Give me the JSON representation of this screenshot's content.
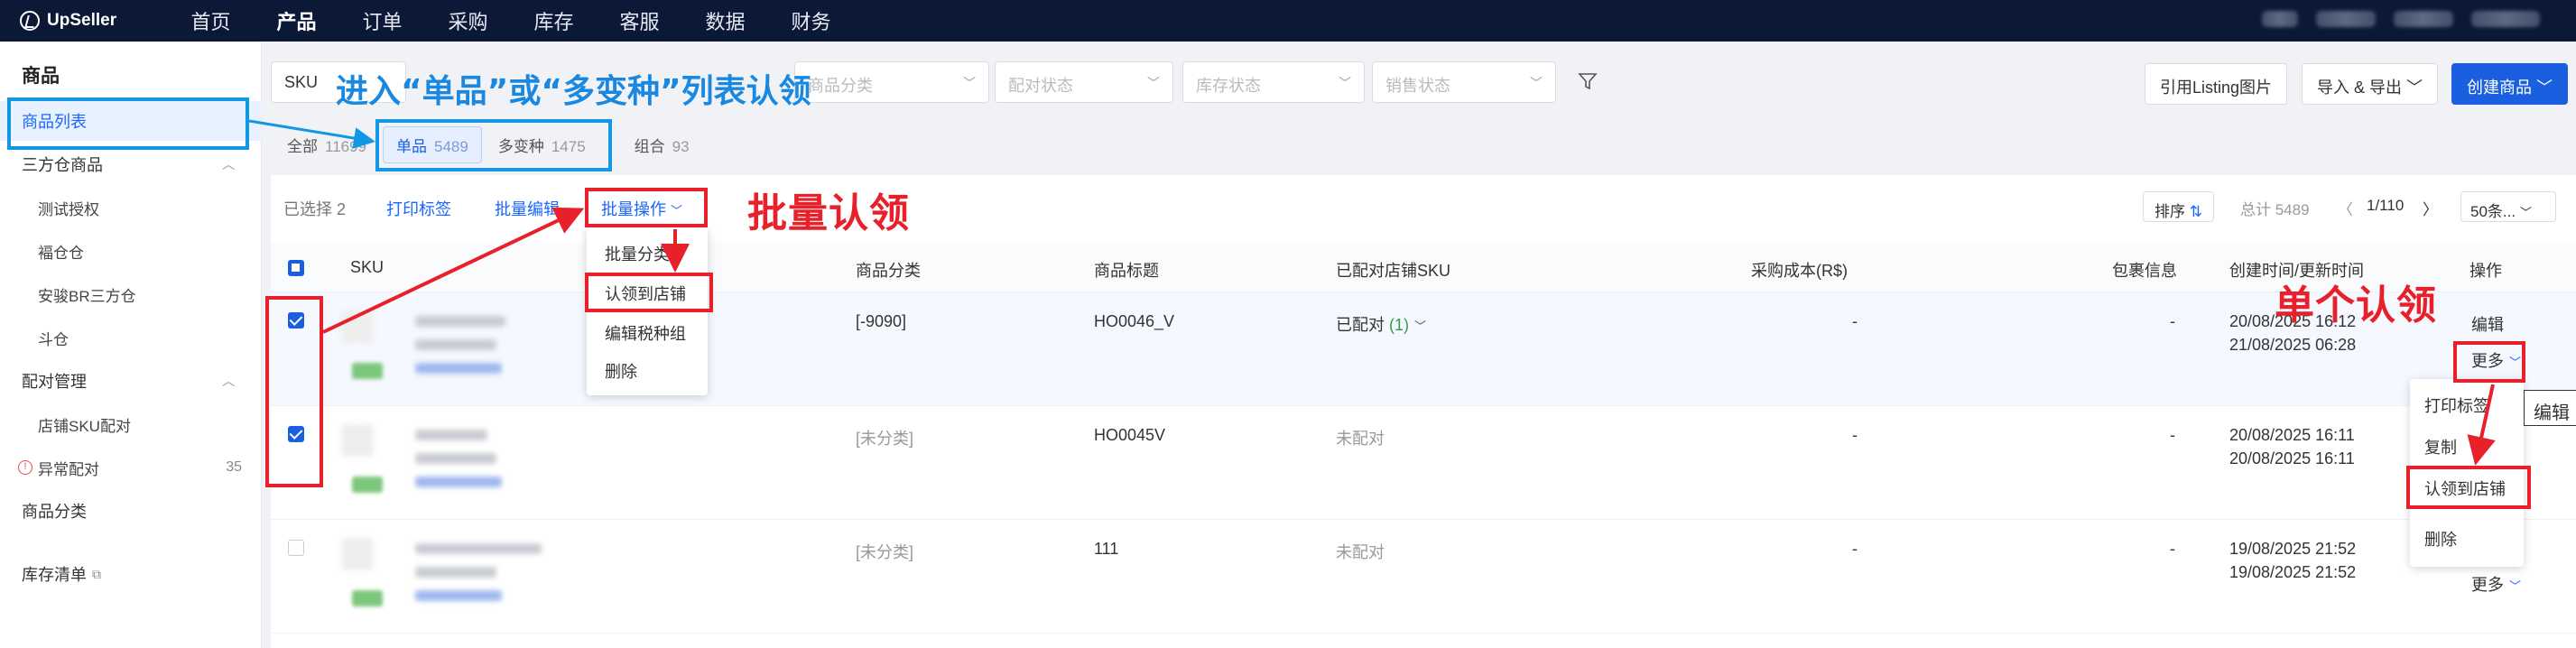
{
  "app": {
    "name": "UpSeller"
  },
  "topnav": {
    "items": [
      "首页",
      "产品",
      "订单",
      "采购",
      "库存",
      "客服",
      "数据",
      "财务"
    ],
    "active_index": 1
  },
  "sidebar": {
    "title": "商品",
    "items": [
      {
        "label": "商品列表",
        "active": true
      },
      {
        "label": "三方仓商品",
        "expandable": true
      },
      {
        "label": "测试授权"
      },
      {
        "label": "褔仓仓"
      },
      {
        "label": "安骏BR三方仓"
      },
      {
        "label": "斗仓"
      },
      {
        "label": "配对管理",
        "expandable": true
      },
      {
        "label": "店铺SKU配对"
      },
      {
        "label": "异常配对",
        "count": "35",
        "icon": "warning-icon"
      },
      {
        "label": "商品分类"
      },
      {
        "label": "库存清单",
        "icon": "external-link-icon"
      }
    ]
  },
  "filters": {
    "sku_select": "SKU",
    "category_placeholder": "商品分类",
    "pair_status_placeholder": "配对状态",
    "stock_status_placeholder": "库存状态",
    "sales_status_placeholder": "销售状态"
  },
  "toolbar_buttons": {
    "cite_listing": "引用Listing图片",
    "import_export": "导入 & 导出",
    "create": "创建商品"
  },
  "tabs": [
    {
      "label": "全部",
      "count": "11699"
    },
    {
      "label": "单品",
      "count": "5489",
      "selected": true
    },
    {
      "label": "多变种",
      "count": "1475"
    },
    {
      "label": "组合",
      "count": "93"
    }
  ],
  "bulkbar": {
    "selected": "已选择 2",
    "print": "打印标签",
    "batch_edit": "批量编辑",
    "batch_ops": "批量操作",
    "sort": "排序",
    "total": "总计 5489",
    "page": "1/110",
    "per_page": "50条..."
  },
  "batch_menu": [
    "批量分类",
    "认领到店铺",
    "编辑税种组",
    "删除"
  ],
  "table": {
    "headers": [
      "SKU",
      "商品分类",
      "商品标题",
      "已配对店铺SKU",
      "采购成本(R$)",
      "包裹信息",
      "创建时间/更新时间",
      "操作"
    ],
    "rows": [
      {
        "checked": true,
        "category": "[-9090]",
        "title": "HO0046_V",
        "paired": "已配对",
        "paired_count": "(1)",
        "cost": "-",
        "package": "-",
        "created": "20/08/2025 16:12",
        "updated": "21/08/2025 06:28",
        "edit": "编辑",
        "more": "更多"
      },
      {
        "checked": true,
        "category": "[未分类]",
        "title": "HO0045V",
        "paired": "未配对",
        "cost": "-",
        "package": "-",
        "created": "20/08/2025 16:11",
        "updated": "20/08/2025 16:11"
      },
      {
        "checked": false,
        "category": "[未分类]",
        "title": "111",
        "paired": "未配对",
        "cost": "-",
        "package": "-",
        "created": "19/08/2025 21:52",
        "updated": "19/08/2025 21:52",
        "more": "更多"
      }
    ]
  },
  "more_menu": [
    "打印标签",
    "复制",
    "认领到店铺",
    "删除"
  ],
  "tooltip": "编辑",
  "annotations": {
    "enter_list": "进入“单品”或“多变种”列表认领",
    "batch_claim": "批量认领",
    "single_claim": "单个认领"
  },
  "colors": {
    "nav_bg": "#0b1836",
    "primary": "#1a5fe0",
    "annotation_red": "#e8202a",
    "annotation_blue": "#1197e4"
  }
}
